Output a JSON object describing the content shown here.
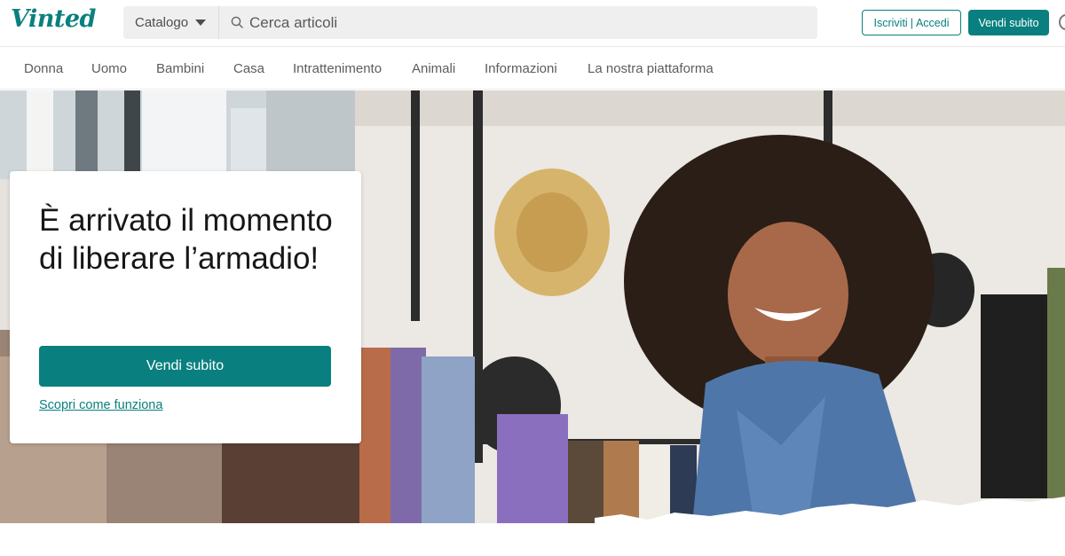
{
  "header": {
    "logo": "Vinted",
    "catalog_label": "Catalogo",
    "search_placeholder": "Cerca articoli",
    "signup_label": "Iscriviti",
    "separator": "|",
    "login_label": "Accedi",
    "sell_label": "Vendi subito"
  },
  "nav": {
    "items": [
      "Donna",
      "Uomo",
      "Bambini",
      "Casa",
      "Intrattenimento",
      "Animali",
      "Informazioni",
      "La nostra piattaforma"
    ]
  },
  "hero": {
    "title": "È arrivato il momento di liberare l’armadio!",
    "cta_label": "Vendi subito",
    "link_label": "Scopri come funziona"
  },
  "colors": {
    "brand": "#09807f",
    "text": "#171717",
    "nav_text": "#5c5c5c"
  },
  "icons": [
    "search-icon",
    "chevron-down-icon",
    "help-icon"
  ]
}
